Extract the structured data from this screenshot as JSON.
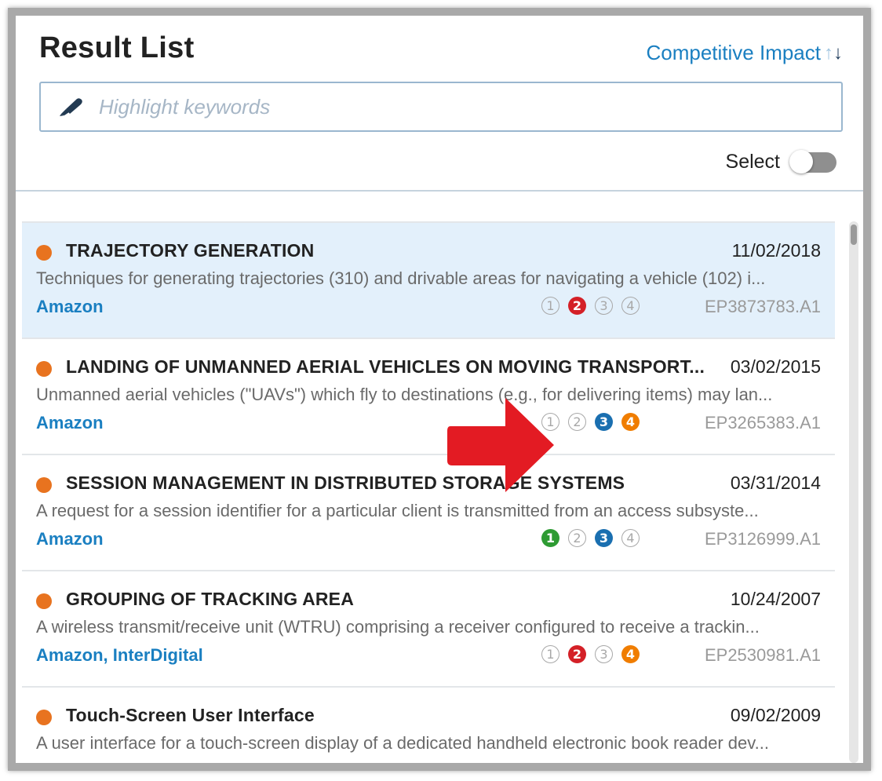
{
  "header": {
    "title": "Result List",
    "sort_label": "Competitive Impact",
    "sort_arrow_up": "↑",
    "sort_arrow_down": "↓"
  },
  "search": {
    "placeholder": "Highlight keywords",
    "value": ""
  },
  "select_toggle": {
    "label": "Select",
    "state": "off"
  },
  "colors": {
    "accent": "#1a7fc1",
    "status_dot": "#e8731f",
    "selected_bg": "#e3f0fb",
    "claim_colors": [
      "#2e9b33",
      "#d42027",
      "#1a6fb0",
      "#f07d00"
    ],
    "annotation_arrow": "#e31b23"
  },
  "results": [
    {
      "title": "TRAJECTORY GENERATION",
      "date": "11/02/2018",
      "description": "Techniques for generating trajectories (310) and drivable areas for navigating a vehicle (102) i...",
      "assignee": "Amazon",
      "claims": [
        {
          "label": "1",
          "active": false
        },
        {
          "label": "2",
          "active": true
        },
        {
          "label": "3",
          "active": false
        },
        {
          "label": "4",
          "active": false
        }
      ],
      "number": "EP3873783.A1",
      "selected": true
    },
    {
      "title": "LANDING OF UNMANNED AERIAL VEHICLES ON MOVING TRANSPORT...",
      "date": "03/02/2015",
      "description": "Unmanned aerial vehicles (\"UAVs\") which fly to destinations (e.g., for delivering items) may lan...",
      "assignee": "Amazon",
      "claims": [
        {
          "label": "1",
          "active": false
        },
        {
          "label": "2",
          "active": false
        },
        {
          "label": "3",
          "active": true
        },
        {
          "label": "4",
          "active": true
        }
      ],
      "number": "EP3265383.A1",
      "selected": false
    },
    {
      "title": "SESSION MANAGEMENT IN DISTRIBUTED STORAGE SYSTEMS",
      "date": "03/31/2014",
      "description": "A request for a session identifier for a particular client is transmitted from an access subsyste...",
      "assignee": "Amazon",
      "claims": [
        {
          "label": "1",
          "active": true
        },
        {
          "label": "2",
          "active": false
        },
        {
          "label": "3",
          "active": true
        },
        {
          "label": "4",
          "active": false
        }
      ],
      "number": "EP3126999.A1",
      "selected": false
    },
    {
      "title": "GROUPING OF TRACKING AREA",
      "date": "10/24/2007",
      "description": "A wireless transmit/receive unit (WTRU) comprising a receiver configured to receive a trackin...",
      "assignee": "Amazon, InterDigital",
      "claims": [
        {
          "label": "1",
          "active": false
        },
        {
          "label": "2",
          "active": true
        },
        {
          "label": "3",
          "active": false
        },
        {
          "label": "4",
          "active": true
        }
      ],
      "number": "EP2530981.A1",
      "selected": false
    },
    {
      "title": "Touch-Screen User Interface",
      "date": "09/02/2009",
      "description": "A user interface for a touch-screen display of a dedicated handheld electronic book reader dev...",
      "assignee": "",
      "claims": [],
      "number": "",
      "selected": false
    }
  ]
}
